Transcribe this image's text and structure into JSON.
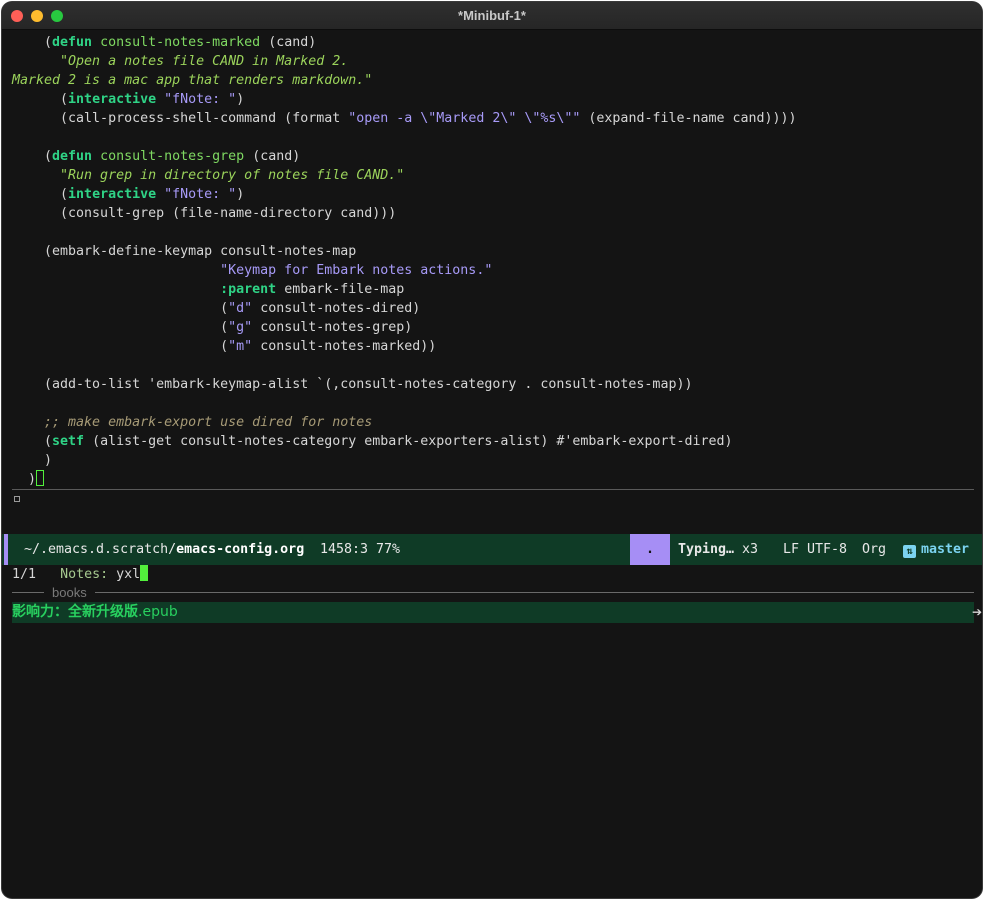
{
  "window": {
    "title": "*Minibuf-1*"
  },
  "code_lines": [
    [
      {
        "c": "",
        "t": "    ("
      },
      {
        "c": "kw",
        "t": "defun"
      },
      {
        "c": "",
        "t": " "
      },
      {
        "c": "fn",
        "t": "consult-notes-marked"
      },
      {
        "c": "",
        "t": " (cand)"
      }
    ],
    [
      {
        "c": "doc",
        "t": "      \"Open a notes file CAND in Marked 2."
      }
    ],
    [
      {
        "c": "doc",
        "t": "Marked 2 is a mac app that renders markdown.\""
      }
    ],
    [
      {
        "c": "",
        "t": "      ("
      },
      {
        "c": "kw",
        "t": "interactive"
      },
      {
        "c": "",
        "t": " "
      },
      {
        "c": "str",
        "t": "\"fNote: \""
      },
      {
        "c": "",
        "t": ")"
      }
    ],
    [
      {
        "c": "",
        "t": "      (call-process-shell-command (format "
      },
      {
        "c": "str",
        "t": "\"open -a \\\"Marked 2\\\" \\\"%s\\\"\""
      },
      {
        "c": "",
        "t": " (expand-file-name cand))))"
      }
    ],
    [
      {
        "c": "",
        "t": ""
      }
    ],
    [
      {
        "c": "",
        "t": "    ("
      },
      {
        "c": "kw",
        "t": "defun"
      },
      {
        "c": "",
        "t": " "
      },
      {
        "c": "fn",
        "t": "consult-notes-grep"
      },
      {
        "c": "",
        "t": " (cand)"
      }
    ],
    [
      {
        "c": "doc",
        "t": "      \"Run grep in directory of notes file CAND.\""
      }
    ],
    [
      {
        "c": "",
        "t": "      ("
      },
      {
        "c": "kw",
        "t": "interactive"
      },
      {
        "c": "",
        "t": " "
      },
      {
        "c": "str",
        "t": "\"fNote: \""
      },
      {
        "c": "",
        "t": ")"
      }
    ],
    [
      {
        "c": "",
        "t": "      (consult-grep (file-name-directory cand)))"
      }
    ],
    [
      {
        "c": "",
        "t": ""
      }
    ],
    [
      {
        "c": "",
        "t": "    (embark-define-keymap consult-notes-map"
      }
    ],
    [
      {
        "c": "",
        "t": "                          "
      },
      {
        "c": "str",
        "t": "\"Keymap for Embark notes actions.\""
      }
    ],
    [
      {
        "c": "",
        "t": "                          "
      },
      {
        "c": "key",
        "t": ":parent"
      },
      {
        "c": "",
        "t": " embark-file-map"
      }
    ],
    [
      {
        "c": "",
        "t": "                          ("
      },
      {
        "c": "str",
        "t": "\"d\""
      },
      {
        "c": "",
        "t": " consult-notes-dired)"
      }
    ],
    [
      {
        "c": "",
        "t": "                          ("
      },
      {
        "c": "str",
        "t": "\"g\""
      },
      {
        "c": "",
        "t": " consult-notes-grep)"
      }
    ],
    [
      {
        "c": "",
        "t": "                          ("
      },
      {
        "c": "str",
        "t": "\"m\""
      },
      {
        "c": "",
        "t": " consult-notes-marked))"
      }
    ],
    [
      {
        "c": "",
        "t": ""
      }
    ],
    [
      {
        "c": "",
        "t": "    (add-to-list 'embark-keymap-alist `(,consult-notes-category . consult-notes-map))"
      }
    ],
    [
      {
        "c": "",
        "t": ""
      }
    ],
    [
      {
        "c": "cmt",
        "t": "    ;; make embark-export use dired for notes"
      }
    ],
    [
      {
        "c": "",
        "t": "    ("
      },
      {
        "c": "kw",
        "t": "setf"
      },
      {
        "c": "",
        "t": " (alist-get consult-notes-category embark-exporters-alist) #'embark-export-dired)"
      }
    ],
    [
      {
        "c": "",
        "t": "    )"
      }
    ],
    [
      {
        "c": "",
        "t": "  )"
      }
    ]
  ],
  "modeline": {
    "path_prefix": "~/.emacs.d.scratch/",
    "file_name": "emacs-config.org",
    "position": "1458:3 77%",
    "indicator": ".",
    "typing": "Typing…",
    "typing_count": " x3",
    "encoding": "LF UTF-8",
    "major_mode": "Org",
    "branch": "master",
    "branch_icon": "git-branch-icon"
  },
  "minibuffer": {
    "counter": "1/1",
    "prompt": "Notes: ",
    "input": "yxl"
  },
  "completion": {
    "group": "books",
    "candidate_main": "影响力：全新升级版",
    "candidate_ext": ".epub"
  },
  "colors": {
    "background": "#141414",
    "modeline": "#0f3b26",
    "accent": "#a68ef5",
    "cursor": "#52f03c"
  }
}
